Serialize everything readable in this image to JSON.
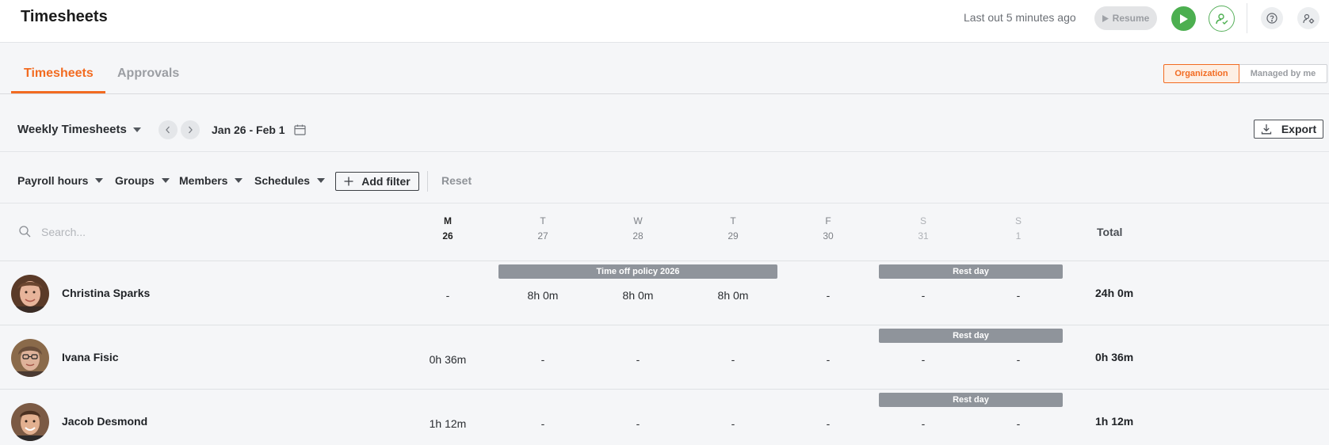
{
  "header": {
    "title": "Timesheets",
    "last_out": "Last out 5 minutes ago",
    "resume_label": "Resume",
    "play_icon": "play-icon",
    "user_icon": "user-check-icon",
    "help_icon": "help-icon",
    "settings_icon": "settings-icon"
  },
  "tabs": [
    {
      "label": "Timesheets",
      "active": true
    },
    {
      "label": "Approvals",
      "active": false
    }
  ],
  "scope": {
    "organization": "Organization",
    "managed": "Managed by me",
    "selected": "Organization"
  },
  "week": {
    "view_label": "Weekly Timesheets",
    "date_range": "Jan 26 - Feb 1",
    "export_label": "Export"
  },
  "filters": {
    "items": [
      "Payroll hours",
      "Groups",
      "Members",
      "Schedules"
    ],
    "add_label": "Add filter",
    "reset_label": "Reset"
  },
  "table": {
    "search_placeholder": "Search...",
    "days": [
      {
        "letter": "M",
        "date": "26"
      },
      {
        "letter": "T",
        "date": "27"
      },
      {
        "letter": "W",
        "date": "28"
      },
      {
        "letter": "T",
        "date": "29"
      },
      {
        "letter": "F",
        "date": "30"
      },
      {
        "letter": "S",
        "date": "31"
      },
      {
        "letter": "S",
        "date": "1"
      }
    ],
    "total_label": "Total",
    "rows": [
      {
        "name": "Christina Sparks",
        "cells": [
          "-",
          "8h 0m",
          "8h 0m",
          "8h 0m",
          "-",
          "-",
          "-"
        ],
        "total": "24h 0m",
        "time_off": "Time off policy 2026",
        "rest": "Rest day"
      },
      {
        "name": "Ivana Fisic",
        "cells": [
          "0h 36m",
          "-",
          "-",
          "-",
          "-",
          "-",
          "-"
        ],
        "total": "0h 36m",
        "rest": "Rest day"
      },
      {
        "name": "Jacob Desmond",
        "cells": [
          "1h 12m",
          "-",
          "-",
          "-",
          "-",
          "-",
          "-"
        ],
        "total": "1h 12m",
        "rest": "Rest day"
      }
    ]
  },
  "colors": {
    "accent": "#f26b21",
    "play": "#4caf50",
    "bar": "#8f949b"
  }
}
